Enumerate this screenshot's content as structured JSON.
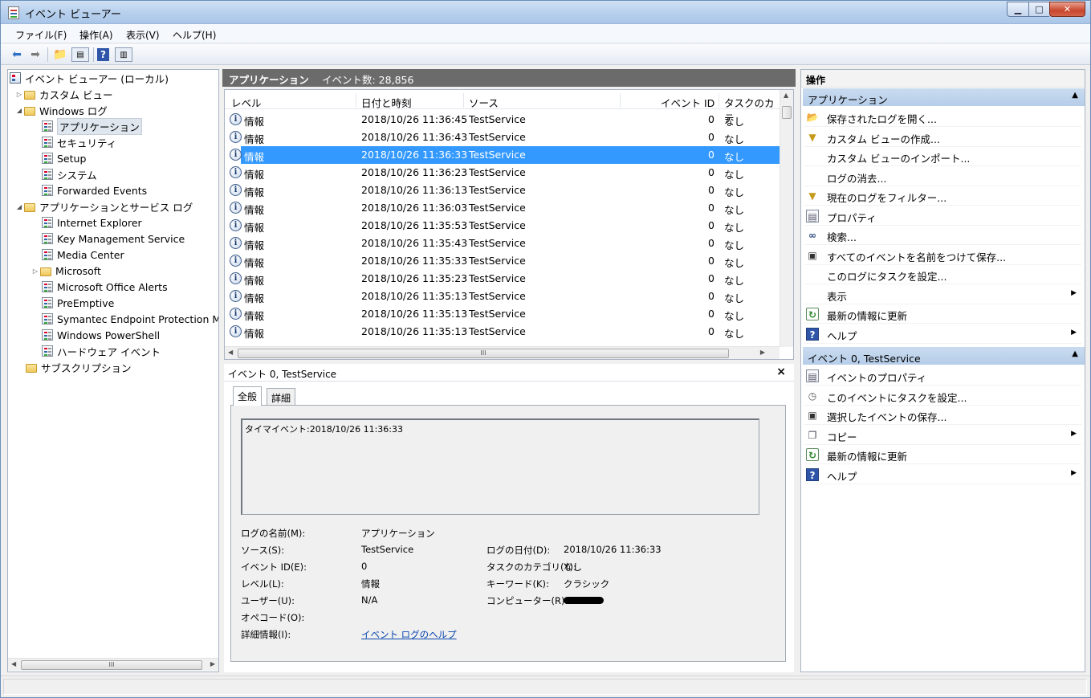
{
  "window": {
    "title": "イベント ビューアー"
  },
  "menu": [
    "ファイル(F)",
    "操作(A)",
    "表示(V)",
    "ヘルプ(H)"
  ],
  "toolbar": {
    "icons": [
      "back-arrow-icon",
      "forward-arrow-icon",
      "up-folder-icon",
      "show-hide-tree-icon",
      "help-icon",
      "show-hide-action-pane-icon"
    ]
  },
  "tree": {
    "root": "イベント ビューアー (ローカル)",
    "custom_views": "カスタム ビュー",
    "windows_logs": "Windows ログ",
    "windows_log_items": [
      "アプリケーション",
      "セキュリティ",
      "Setup",
      "システム",
      "Forwarded Events"
    ],
    "app_service_logs": "アプリケーションとサービス ログ",
    "app_service_items": [
      "Internet Explorer",
      "Key Management Service",
      "Media Center",
      "Microsoft",
      "Microsoft Office Alerts",
      "PreEmptive",
      "Symantec Endpoint Protection Ma",
      "Windows PowerShell",
      "ハードウェア イベント"
    ],
    "subscriptions": "サブスクリプション",
    "scroll_thumb": "III"
  },
  "center": {
    "log_name": "アプリケーション",
    "event_count": "イベント数: 28,856",
    "columns": [
      "レベル",
      "日付と時刻",
      "ソース",
      "イベント ID",
      "タスクのカテ"
    ],
    "rows": [
      {
        "level": "情報",
        "datetime": "2018/10/26 11:36:45",
        "source": "TestService",
        "id": "0",
        "task": "なし"
      },
      {
        "level": "情報",
        "datetime": "2018/10/26 11:36:43",
        "source": "TestService",
        "id": "0",
        "task": "なし"
      },
      {
        "level": "情報",
        "datetime": "2018/10/26 11:36:33",
        "source": "TestService",
        "id": "0",
        "task": "なし"
      },
      {
        "level": "情報",
        "datetime": "2018/10/26 11:36:23",
        "source": "TestService",
        "id": "0",
        "task": "なし"
      },
      {
        "level": "情報",
        "datetime": "2018/10/26 11:36:13",
        "source": "TestService",
        "id": "0",
        "task": "なし"
      },
      {
        "level": "情報",
        "datetime": "2018/10/26 11:36:03",
        "source": "TestService",
        "id": "0",
        "task": "なし"
      },
      {
        "level": "情報",
        "datetime": "2018/10/26 11:35:53",
        "source": "TestService",
        "id": "0",
        "task": "なし"
      },
      {
        "level": "情報",
        "datetime": "2018/10/26 11:35:43",
        "source": "TestService",
        "id": "0",
        "task": "なし"
      },
      {
        "level": "情報",
        "datetime": "2018/10/26 11:35:33",
        "source": "TestService",
        "id": "0",
        "task": "なし"
      },
      {
        "level": "情報",
        "datetime": "2018/10/26 11:35:23",
        "source": "TestService",
        "id": "0",
        "task": "なし"
      },
      {
        "level": "情報",
        "datetime": "2018/10/26 11:35:13",
        "source": "TestService",
        "id": "0",
        "task": "なし"
      },
      {
        "level": "情報",
        "datetime": "2018/10/26 11:35:13",
        "source": "TestService",
        "id": "0",
        "task": "なし"
      },
      {
        "level": "情報",
        "datetime": "2018/10/26 11:35:13",
        "source": "TestService",
        "id": "0",
        "task": "なし"
      }
    ],
    "selected_row": 2,
    "scroll_thumb": "III"
  },
  "detail": {
    "title": "イベント 0, TestService",
    "close": "×",
    "tabs": [
      "全般",
      "詳細"
    ],
    "description": "タイマイベント:2018/10/26 11:36:33",
    "labels": {
      "log_name": "ログの名前(M):",
      "source": "ソース(S):",
      "event_id": "イベント ID(E):",
      "level": "レベル(L):",
      "user": "ユーザー(U):",
      "opcode": "オペコード(O):",
      "more_info": "詳細情報(I):",
      "logged": "ログの日付(D):",
      "task_category": "タスクのカテゴリ(Y):",
      "keywords": "キーワード(K):",
      "computer": "コンピューター(R):"
    },
    "values": {
      "log_name": "アプリケーション",
      "source": "TestService",
      "event_id": "0",
      "level": "情報",
      "user": "N/A",
      "more_info_link": "イベント ログのヘルプ",
      "logged": "2018/10/26 11:36:33",
      "task_category": "なし",
      "keywords": "クラシック"
    }
  },
  "actions": {
    "header": "操作",
    "section1": "アプリケーション",
    "items1": [
      {
        "label": "保存されたログを開く...",
        "icon": "open-folder-icon"
      },
      {
        "label": "カスタム ビューの作成...",
        "icon": "filter-icon"
      },
      {
        "label": "カスタム ビューのインポート...",
        "icon": ""
      },
      {
        "label": "ログの消去...",
        "icon": ""
      },
      {
        "label": "現在のログをフィルター...",
        "icon": "filter-icon"
      },
      {
        "label": "プロパティ",
        "icon": "properties-icon"
      },
      {
        "label": "検索...",
        "icon": "binoculars-icon"
      },
      {
        "label": "すべてのイベントを名前をつけて保存...",
        "icon": "save-icon"
      },
      {
        "label": "このログにタスクを設定...",
        "icon": ""
      },
      {
        "label": "表示",
        "icon": "",
        "submenu": true
      },
      {
        "label": "最新の情報に更新",
        "icon": "refresh-icon"
      },
      {
        "label": "ヘルプ",
        "icon": "help-icon",
        "submenu": true
      }
    ],
    "section2": "イベント 0, TestService",
    "items2": [
      {
        "label": "イベントのプロパティ",
        "icon": "properties-icon"
      },
      {
        "label": "このイベントにタスクを設定...",
        "icon": "task-icon"
      },
      {
        "label": "選択したイベントの保存...",
        "icon": "save-icon"
      },
      {
        "label": "コピー",
        "icon": "copy-icon",
        "submenu": true
      },
      {
        "label": "最新の情報に更新",
        "icon": "refresh-icon"
      },
      {
        "label": "ヘルプ",
        "icon": "help-icon",
        "submenu": true
      }
    ]
  },
  "colors": {
    "selection": "#3399ff",
    "section_header": "#c9dbef",
    "center_header": "#6b6b6b",
    "link": "#0645ad"
  }
}
